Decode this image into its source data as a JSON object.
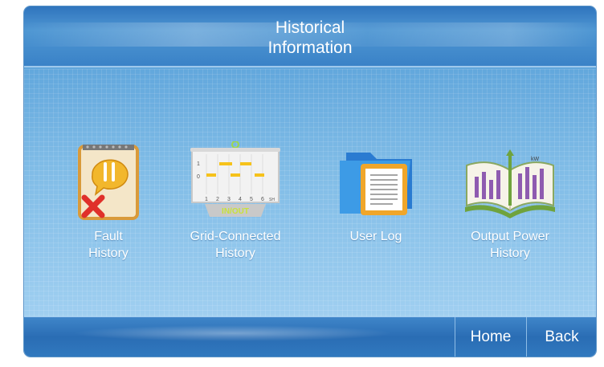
{
  "header": {
    "title_line1": "Historical",
    "title_line2": "Information"
  },
  "menu": [
    {
      "line1": "Fault",
      "line2": "History",
      "icon": "fault-history-icon"
    },
    {
      "line1": "Grid-Connected",
      "line2": "History",
      "icon": "grid-connected-icon",
      "icon_text": "IN/OUT",
      "chart_labels": [
        "1",
        "0",
        "1",
        "2",
        "3",
        "4",
        "5",
        "6",
        "SH"
      ]
    },
    {
      "line1": "User Log",
      "line2": "",
      "icon": "user-log-folder-icon"
    },
    {
      "line1": "Output Power",
      "line2": "History",
      "icon": "output-power-book-icon",
      "icon_text": "kW"
    }
  ],
  "footer": {
    "home_label": "Home",
    "back_label": "Back"
  },
  "colors": {
    "header": "#3a82c7",
    "panel": "#7fbbe6",
    "footer": "#2a6db4",
    "text": "#ffffff"
  }
}
